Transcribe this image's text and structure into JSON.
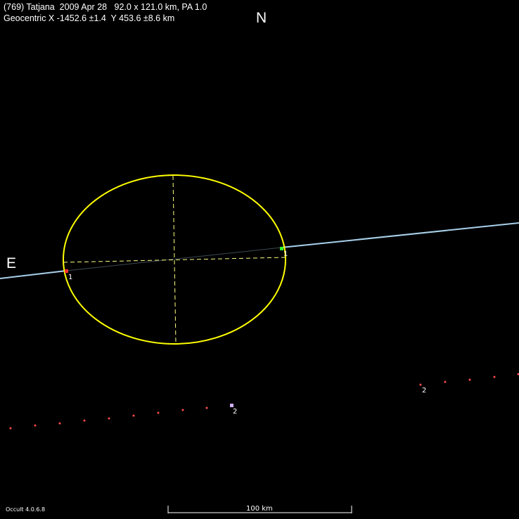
{
  "header": {
    "line1": "(769) Tatjana  2009 Apr 28   92.0 x 121.0 km, PA 1.0",
    "line2": "Geocentric X -1452.6 ±1.4  Y 453.6 ±8.6 km"
  },
  "compass": {
    "north": "N",
    "east": "E"
  },
  "chords": [
    {
      "label": "1",
      "color": "#a8d0ea"
    }
  ],
  "observers_miss": [
    {
      "label": "2",
      "color": "#ff4a4a"
    }
  ],
  "ellipse": {
    "major_km": 121.0,
    "minor_km": 92.0,
    "pa_deg": 1.0,
    "color": "#ffff00"
  },
  "scale": {
    "label": "100 km"
  },
  "footer": {
    "version": "Occult 4.0.6.8"
  }
}
